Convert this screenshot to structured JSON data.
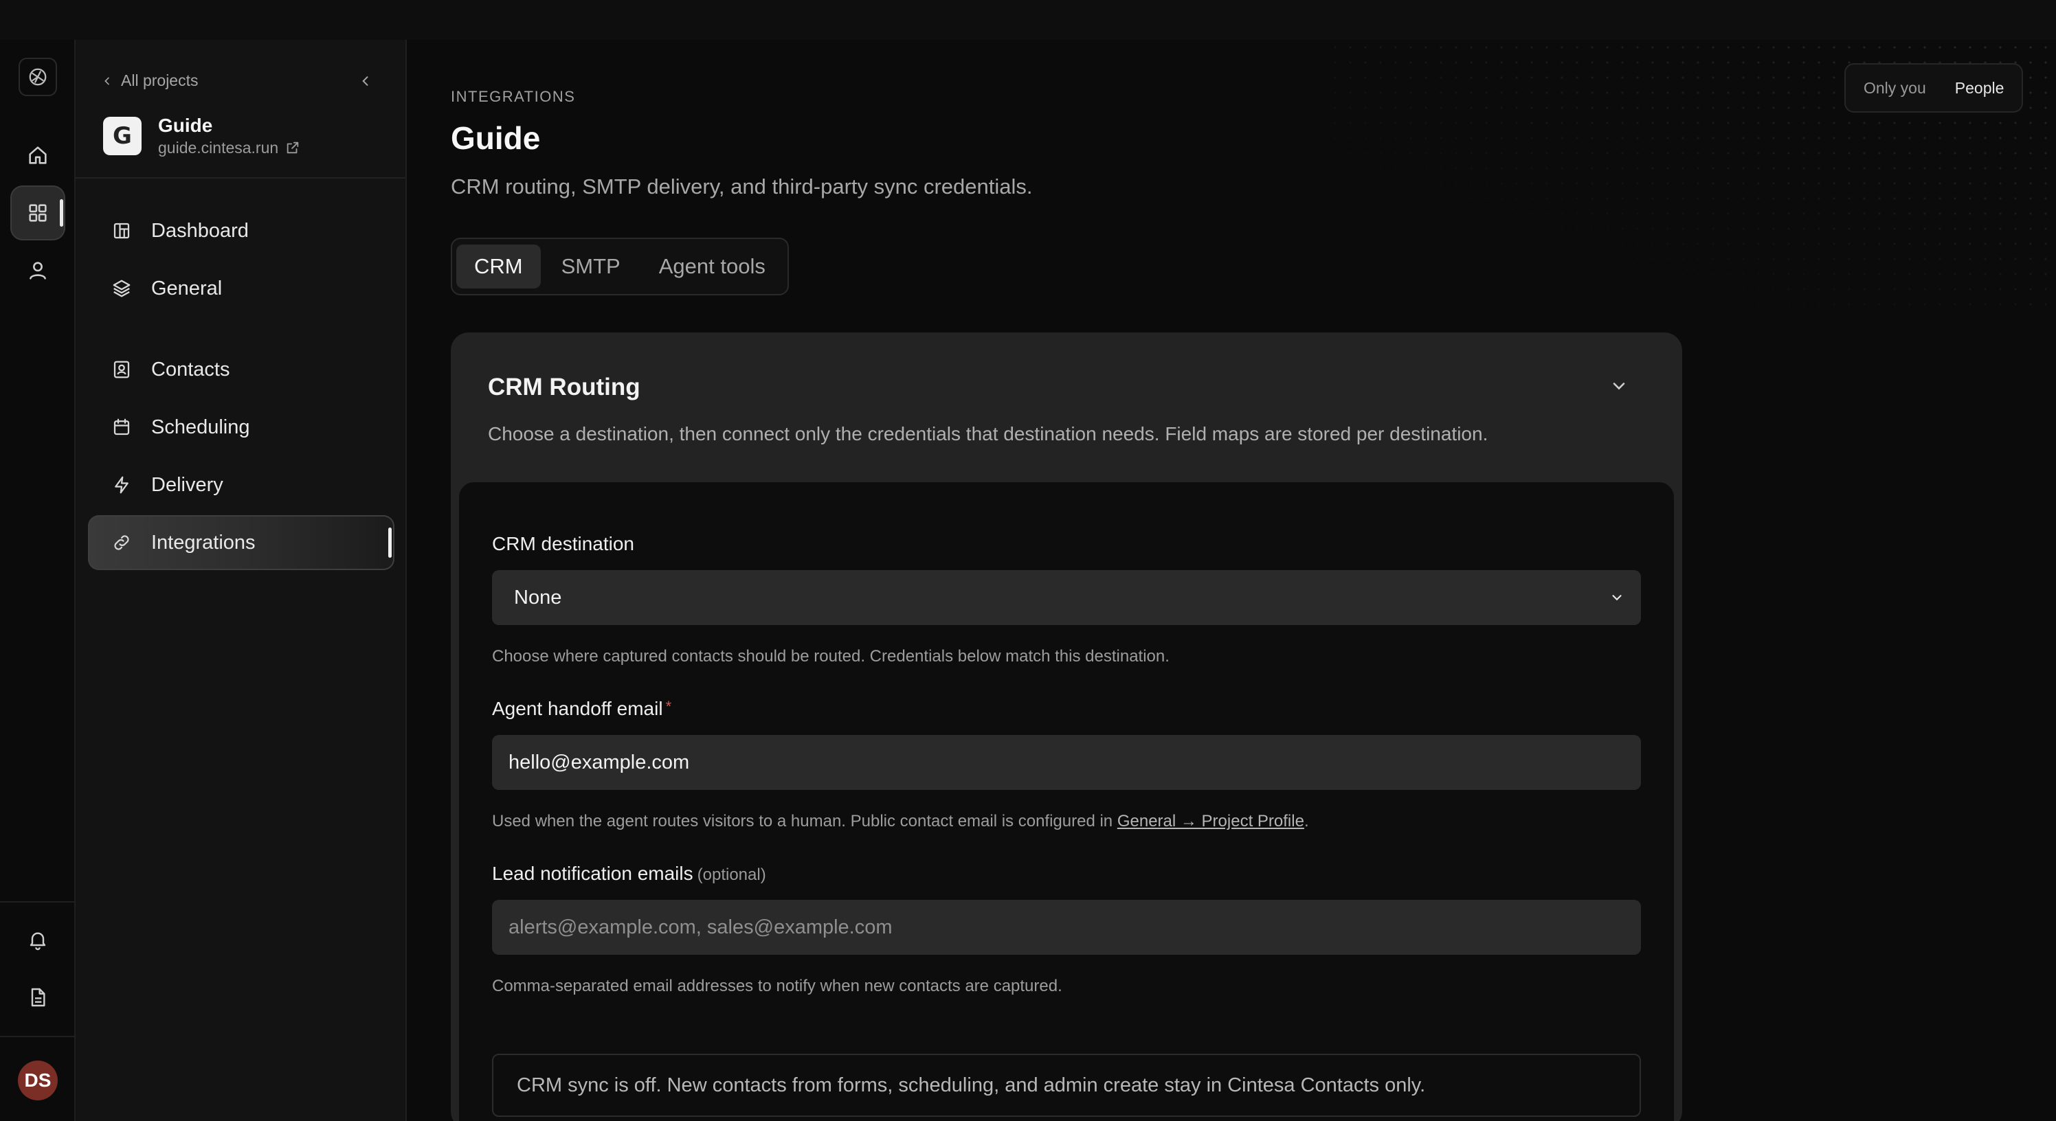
{
  "rail": {
    "logo_icon": "cintesa-logo-icon",
    "items": [
      {
        "icon": "home-icon"
      },
      {
        "icon": "grid-icon",
        "active": true
      },
      {
        "icon": "user-icon"
      }
    ],
    "bottom": [
      {
        "icon": "bell-icon"
      },
      {
        "icon": "document-icon"
      }
    ],
    "avatar_initials": "DS",
    "avatar_color": "#7a2e26"
  },
  "sidebar": {
    "back_label": "All projects",
    "project": {
      "name": "Guide",
      "url": "guide.cintesa.run",
      "logo_text": "G"
    },
    "items": [
      {
        "label": "Dashboard",
        "icon": "dashboard-icon"
      },
      {
        "label": "General",
        "icon": "layers-icon"
      },
      {
        "label": "Contacts",
        "icon": "contact-card-icon"
      },
      {
        "label": "Scheduling",
        "icon": "calendar-icon"
      },
      {
        "label": "Delivery",
        "icon": "lightning-icon"
      },
      {
        "label": "Integrations",
        "icon": "link-icon",
        "active": true
      }
    ]
  },
  "header": {
    "eyebrow": "INTEGRATIONS",
    "title": "Guide",
    "subtitle": "CRM routing, SMTP delivery, and third-party sync credentials.",
    "scope": {
      "options": [
        "Only you",
        "People"
      ]
    }
  },
  "tabs": [
    {
      "label": "CRM",
      "active": true
    },
    {
      "label": "SMTP"
    },
    {
      "label": "Agent tools"
    }
  ],
  "card": {
    "title": "CRM Routing",
    "description": "Choose a destination, then connect only the credentials that destination needs. Field maps are stored per destination.",
    "destination": {
      "label": "CRM destination",
      "value": "None",
      "help": "Choose where captured contacts should be routed. Credentials below match this destination."
    },
    "handoff": {
      "label": "Agent handoff email",
      "required_mark": "*",
      "value": "hello@example.com",
      "help_prefix": "Used when the agent routes visitors to a human. Public contact email is configured in ",
      "help_link": "General → Project Profile",
      "help_suffix": "."
    },
    "lead": {
      "label": "Lead notification emails",
      "optional": "(optional)",
      "placeholder": "alerts@example.com, sales@example.com",
      "help": "Comma-separated email addresses to notify when new contacts are captured."
    },
    "notice": "CRM sync is off. New contacts from forms, scheduling, and admin create stay in Cintesa Contacts only."
  },
  "colors": {
    "accent_active": "#2b2b2b",
    "required": "#d9534f"
  }
}
